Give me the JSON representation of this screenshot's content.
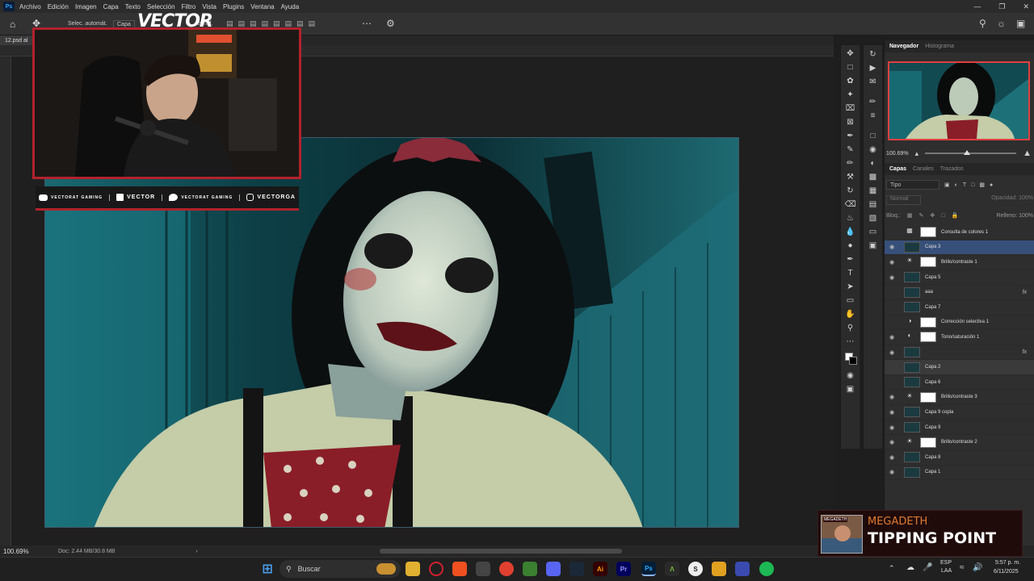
{
  "menubar": {
    "app_icon": "Ps",
    "items": [
      "Archivo",
      "Edición",
      "Imagen",
      "Capa",
      "Texto",
      "Selección",
      "Filtro",
      "Vista",
      "Plugins",
      "Ventana",
      "Ayuda"
    ]
  },
  "optbar": {
    "auto_select": "Selec. automát.",
    "target": "Capa",
    "transform": "transf."
  },
  "document": {
    "tab": "12.psd al",
    "zoom": "100.69%",
    "doc_size": "Doc: 2.44 MB/30.8 MB"
  },
  "overlay": {
    "streamer_name": "VECTOR",
    "socials": [
      {
        "icon": "youtube-icon",
        "label": "VECTORAT GAMING"
      },
      {
        "icon": "twitch-icon",
        "label": "VECTOR"
      },
      {
        "icon": "twitter-icon",
        "label": "VECTORAT GAMING"
      },
      {
        "icon": "instagram-icon",
        "label": "VECTORGA"
      }
    ],
    "accent": "#b2222c"
  },
  "navigator": {
    "tabs": [
      "Navegador",
      "Histograma"
    ],
    "zoom": "100.69%"
  },
  "layers_panel": {
    "tabs": [
      "Capas",
      "Canales",
      "Trazados"
    ],
    "filter": "Tipo",
    "blend_mode": "Normal",
    "opacity_label": "Opacidad:",
    "opacity": "100%",
    "lock_label": "Bloq.:",
    "fill_label": "Relleno:",
    "fill": "100%",
    "layers": [
      {
        "name": "Consulta de colores 1",
        "kind": "adjustment",
        "icon": "grid-icon",
        "visible": false,
        "mask": true,
        "fx": false,
        "selected": false
      },
      {
        "name": "Capa 3",
        "kind": "pixel",
        "visible": true,
        "mask": false,
        "fx": false,
        "selected": true
      },
      {
        "name": "Brillo/contraste 1",
        "kind": "adjustment",
        "icon": "sun-icon",
        "visible": true,
        "mask": true,
        "fx": false,
        "selected": false
      },
      {
        "name": "Capa 5",
        "kind": "pixel",
        "visible": true,
        "mask": false,
        "fx": false,
        "selected": false
      },
      {
        "name": "aaa",
        "kind": "pixel",
        "visible": false,
        "mask": false,
        "fx": true,
        "selected": false
      },
      {
        "name": "Capa 7",
        "kind": "pixel",
        "visible": false,
        "mask": false,
        "fx": false,
        "selected": false
      },
      {
        "name": "Corrección selectiva 1",
        "kind": "adjustment",
        "icon": "selective-color-icon",
        "visible": false,
        "mask": true,
        "fx": false,
        "selected": false
      },
      {
        "name": "Tono/saturación 1",
        "kind": "adjustment",
        "icon": "hue-sat-icon",
        "visible": true,
        "mask": true,
        "fx": false,
        "selected": false
      },
      {
        "name": "",
        "kind": "pixel",
        "visible": true,
        "mask": false,
        "fx": true,
        "selected": false
      },
      {
        "name": "Capa 2",
        "kind": "pixel",
        "visible": false,
        "mask": false,
        "fx": false,
        "selected": false,
        "dim": true
      },
      {
        "name": "Capa 6",
        "kind": "pixel",
        "visible": false,
        "mask": false,
        "fx": false,
        "selected": false
      },
      {
        "name": "Brillo/contraste 3",
        "kind": "adjustment",
        "icon": "sun-icon",
        "visible": true,
        "mask": true,
        "fx": false,
        "selected": false
      },
      {
        "name": "Capa 9 copia",
        "kind": "pixel",
        "visible": true,
        "mask": false,
        "fx": false,
        "selected": false
      },
      {
        "name": "Capa 9",
        "kind": "pixel",
        "visible": true,
        "mask": false,
        "fx": false,
        "selected": false
      },
      {
        "name": "Brillo/contraste 2",
        "kind": "adjustment",
        "icon": "sun-icon",
        "visible": true,
        "mask": true,
        "fx": false,
        "selected": false
      },
      {
        "name": "Capa 8",
        "kind": "pixel",
        "visible": true,
        "mask": false,
        "fx": false,
        "selected": false
      },
      {
        "name": "Capa 1",
        "kind": "pixel",
        "visible": true,
        "mask": false,
        "fx": false,
        "selected": false
      }
    ]
  },
  "now_playing": {
    "art_label": "MEGADETH",
    "band": "MEGADETH",
    "track": "TIPPING POINT"
  },
  "taskbar": {
    "search": "Buscar",
    "language": "ESP",
    "language2": "LAA",
    "time": "5:57 p. m.",
    "date": "6/11/2025"
  }
}
